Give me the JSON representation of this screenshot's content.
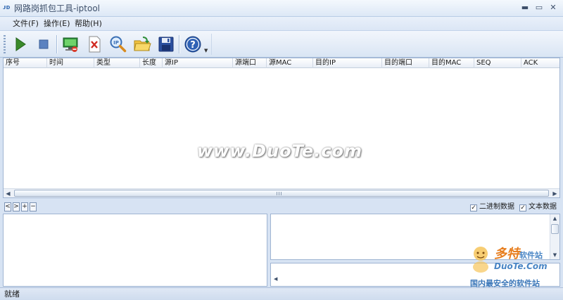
{
  "window": {
    "title": "网路岗抓包工具-iptool",
    "icon_text": "ᴊᴅ"
  },
  "menu": [
    {
      "label": "文件(F)"
    },
    {
      "label": "操作(E)"
    },
    {
      "label": "帮助(H)"
    }
  ],
  "toolbar": {
    "icons": [
      "play-icon",
      "stop-icon",
      "network-monitor-icon",
      "clear-icon",
      "ip-search-icon",
      "open-folder-icon",
      "save-icon",
      "help-icon"
    ],
    "dropdown_glyph": "▼"
  },
  "grid": {
    "columns": [
      "序号",
      "时间",
      "类型",
      "长度",
      "源IP",
      "源端口",
      "源MAC",
      "目的IP",
      "目的端口",
      "目的MAC",
      "SEQ",
      "ACK"
    ],
    "rows": []
  },
  "watermark": "www.DuoTe.com",
  "nav_buttons": [
    "<",
    ">",
    "+",
    "−"
  ],
  "options": [
    {
      "label": "二进制数据",
      "checked": true
    },
    {
      "label": "文本数据",
      "checked": true
    }
  ],
  "check_glyph": "✓",
  "logo": {
    "brand": "多特",
    "brand_suffix": "软件站",
    "domain": "DuoTe.Com",
    "tagline": "国内最安全的软件站"
  },
  "status": {
    "text": "就绪"
  },
  "colors": {
    "accent": "#3a6fb4",
    "brand_orange": "#e77e1f",
    "brand_blue": "#4a86c5"
  }
}
